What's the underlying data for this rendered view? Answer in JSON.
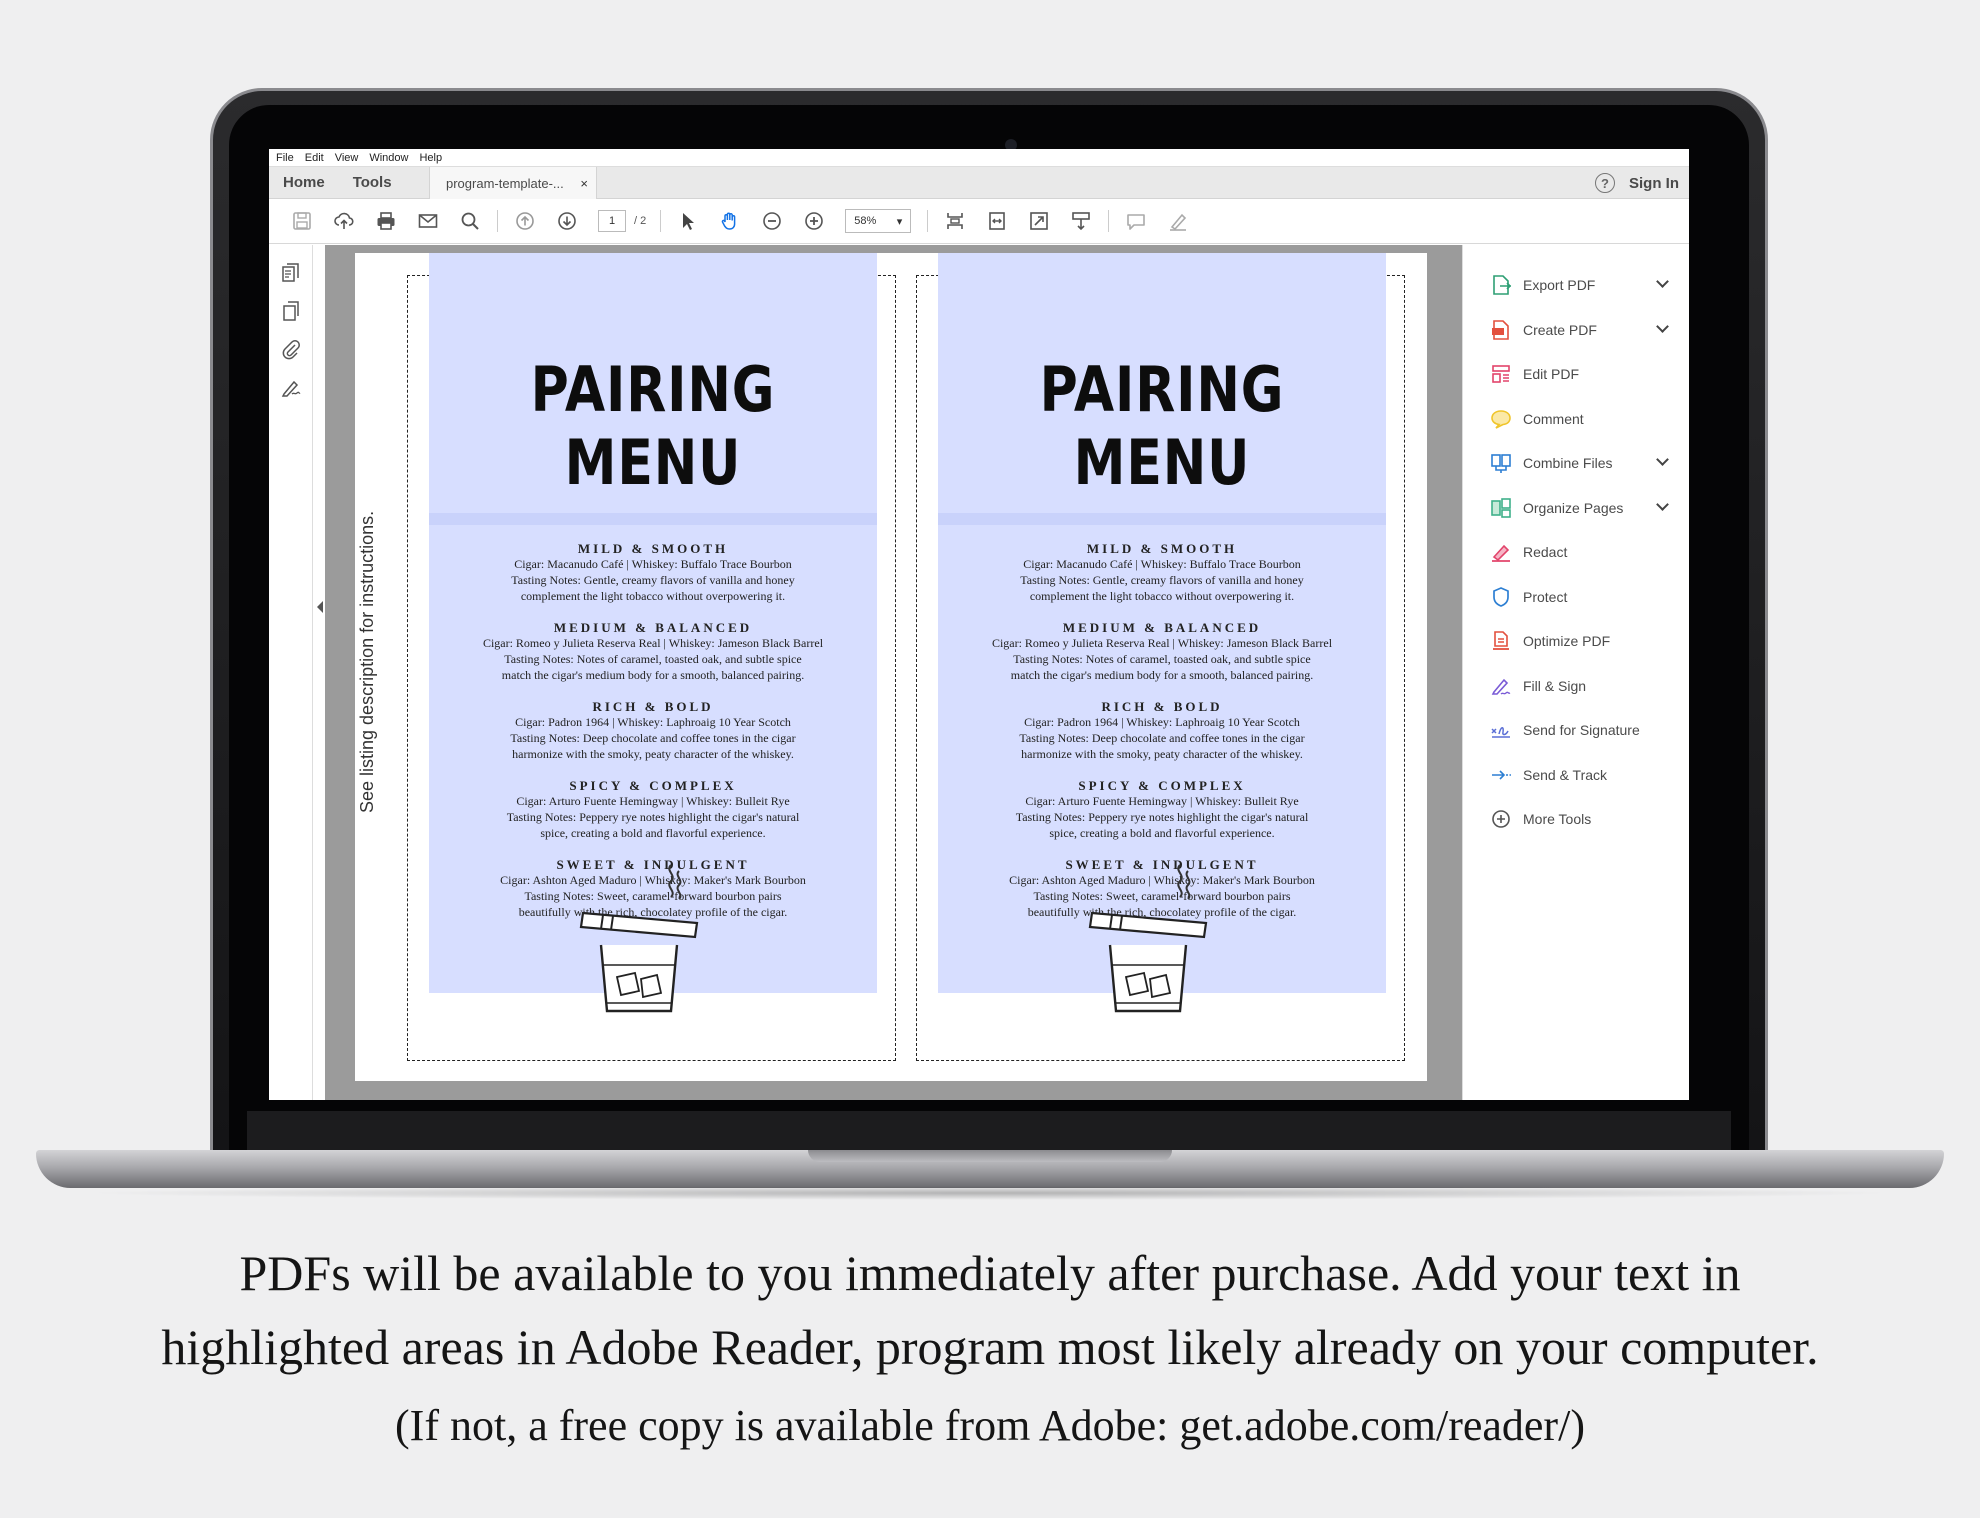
{
  "app": {
    "menu": [
      "File",
      "Edit",
      "View",
      "Window",
      "Help"
    ],
    "nav_tabs": [
      "Home",
      "Tools"
    ],
    "document_tab": "program-template-...",
    "document_tab_close": "×",
    "sign_in": "Sign In",
    "help_glyph": "?"
  },
  "toolbar": {
    "page_current": "1",
    "page_total": "/ 2",
    "zoom": "58%",
    "zoom_caret": "▾"
  },
  "document": {
    "side_note": "See listing description for instructions.",
    "panels": [
      {
        "title": "PAIRING MENU",
        "sections": [
          {
            "heading": "MILD & SMOOTH",
            "lines": [
              "Cigar: Macanudo Café  |  Whiskey: Buffalo Trace Bourbon",
              "Tasting Notes: Gentle, creamy flavors of vanilla and honey",
              "complement the light tobacco without overpowering it."
            ]
          },
          {
            "heading": "MEDIUM & BALANCED",
            "lines": [
              "Cigar: Romeo y Julieta Reserva Real  |  Whiskey: Jameson Black Barrel",
              "Tasting Notes: Notes of caramel, toasted oak, and subtle spice",
              "match the cigar's medium body for a smooth, balanced pairing."
            ]
          },
          {
            "heading": "RICH & BOLD",
            "lines": [
              "Cigar: Padron 1964  |  Whiskey: Laphroaig 10 Year Scotch",
              "Tasting Notes: Deep chocolate and coffee tones in the cigar",
              "harmonize with the smoky, peaty character of the whiskey."
            ]
          },
          {
            "heading": "SPICY & COMPLEX",
            "lines": [
              "Cigar: Arturo Fuente Hemingway  |  Whiskey: Bulleit Rye",
              "Tasting Notes: Peppery rye notes highlight the cigar's natural",
              "spice, creating a bold and flavorful experience."
            ]
          },
          {
            "heading": "SWEET & INDULGENT",
            "lines": [
              "Cigar: Ashton Aged Maduro  |  Whiskey: Maker's Mark Bourbon",
              "Tasting Notes: Sweet, caramel-forward bourbon pairs",
              "beautifully with the rich, chocolatey profile of the cigar."
            ]
          }
        ]
      },
      {
        "title": "PAIRING MENU",
        "sections": [
          {
            "heading": "MILD & SMOOTH",
            "lines": [
              "Cigar: Macanudo Café  |  Whiskey: Buffalo Trace Bourbon",
              "Tasting Notes: Gentle, creamy flavors of vanilla and honey",
              "complement the light tobacco without overpowering it."
            ]
          },
          {
            "heading": "MEDIUM & BALANCED",
            "lines": [
              "Cigar: Romeo y Julieta Reserva Real  |  Whiskey: Jameson Black Barrel",
              "Tasting Notes: Notes of caramel, toasted oak, and subtle spice",
              "match the cigar's medium body for a smooth, balanced pairing."
            ]
          },
          {
            "heading": "RICH & BOLD",
            "lines": [
              "Cigar: Padron 1964  |  Whiskey: Laphroaig 10 Year Scotch",
              "Tasting Notes: Deep chocolate and coffee tones in the cigar",
              "harmonize with the smoky, peaty character of the whiskey."
            ]
          },
          {
            "heading": "SPICY & COMPLEX",
            "lines": [
              "Cigar: Arturo Fuente Hemingway  |  Whiskey: Bulleit Rye",
              "Tasting Notes: Peppery rye notes highlight the cigar's natural",
              "spice, creating a bold and flavorful experience."
            ]
          },
          {
            "heading": "SWEET & INDULGENT",
            "lines": [
              "Cigar: Ashton Aged Maduro  |  Whiskey: Maker's Mark Bourbon",
              "Tasting Notes: Sweet, caramel-forward bourbon pairs",
              "beautifully with the rich, chocolatey profile of the cigar."
            ]
          }
        ]
      }
    ]
  },
  "tools_pane": {
    "items": [
      {
        "label": "Export PDF",
        "icon": "export-pdf-icon",
        "color": "#2e9f74",
        "expandable": true
      },
      {
        "label": "Create PDF",
        "icon": "create-pdf-icon",
        "color": "#e3503e",
        "expandable": true
      },
      {
        "label": "Edit PDF",
        "icon": "edit-pdf-icon",
        "color": "#e2446b",
        "expandable": false
      },
      {
        "label": "Comment",
        "icon": "comment-icon",
        "color": "#f0c52a",
        "expandable": false
      },
      {
        "label": "Combine Files",
        "icon": "combine-files-icon",
        "color": "#2d7fd3",
        "expandable": true
      },
      {
        "label": "Organize Pages",
        "icon": "organize-pages-icon",
        "color": "#3fb08a",
        "expandable": true
      },
      {
        "label": "Redact",
        "icon": "redact-icon",
        "color": "#e2446b",
        "expandable": false
      },
      {
        "label": "Protect",
        "icon": "protect-icon",
        "color": "#2d7fd3",
        "expandable": false
      },
      {
        "label": "Optimize PDF",
        "icon": "optimize-pdf-icon",
        "color": "#e3503e",
        "expandable": false
      },
      {
        "label": "Fill & Sign",
        "icon": "fill-sign-icon",
        "color": "#7a5bd6",
        "expandable": false
      },
      {
        "label": "Send for Signature",
        "icon": "send-for-signature-icon",
        "color": "#5b6fd6",
        "expandable": false
      },
      {
        "label": "Send & Track",
        "icon": "send-track-icon",
        "color": "#2d7fd3",
        "expandable": false
      },
      {
        "label": "More Tools",
        "icon": "more-tools-icon",
        "color": "#555555",
        "expandable": false
      }
    ]
  },
  "caption": {
    "line1": "PDFs will be available  to you immediately after purchase.  Add your text in",
    "line2": "highlighted areas in Adobe Reader, program most likely already on your computer.",
    "line3": "(If not, a free copy is available from Adobe: get.adobe.com/reader/)"
  },
  "colors": {
    "panel_fill": "#d7deff",
    "title_strip": "#c9d2fb",
    "doc_background": "#9b9b9b"
  }
}
